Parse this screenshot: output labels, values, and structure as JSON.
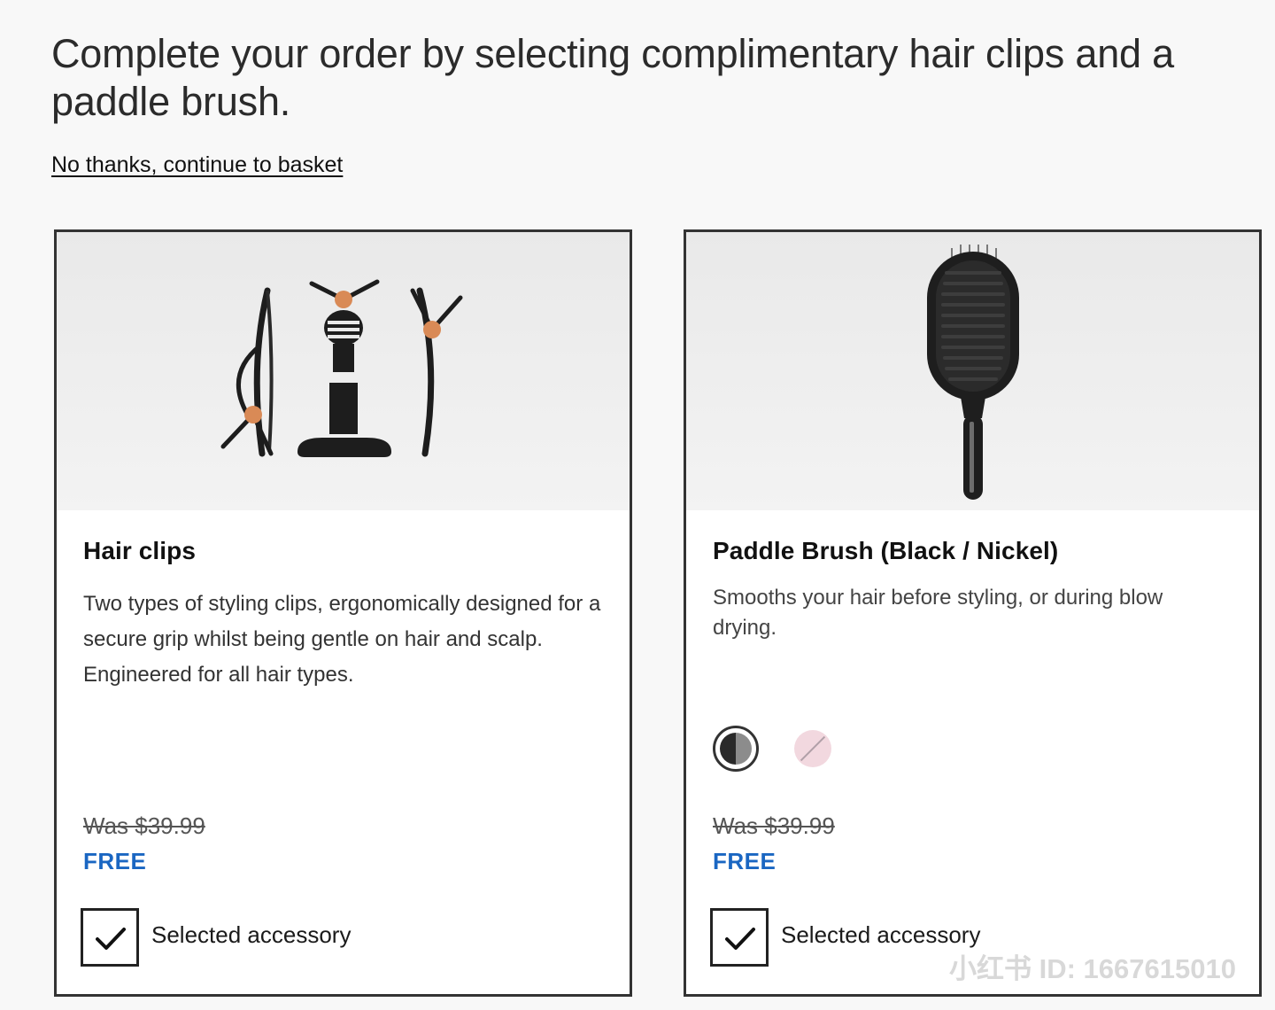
{
  "page": {
    "heading": "Complete your order by selecting complimentary hair clips and a paddle brush.",
    "skip_link": "No thanks, continue to basket"
  },
  "products": [
    {
      "title": "Hair clips",
      "description": "Two types of styling clips, ergonomically designed for a secure grip whilst being gentle on hair and scalp. Engineered for all hair types.",
      "was_price": "Was $39.99",
      "price": "FREE",
      "checkbox_label": "Selected accessory",
      "checked": true
    },
    {
      "title": "Paddle Brush (Black / Nickel)",
      "description": "Smooths your hair before styling, or during blow drying.",
      "swatches": [
        {
          "name": "Black / Nickel",
          "selected": true,
          "color": "#2a2a2a"
        },
        {
          "name": "Pink",
          "selected": false,
          "color": "#f2d8df"
        }
      ],
      "was_price": "Was $39.99",
      "price": "FREE",
      "checkbox_label": "Selected accessory",
      "checked": true
    }
  ],
  "watermark": "小红书 ID: 1667615010",
  "colors": {
    "accent_blue": "#1a66c2",
    "border": "#333333",
    "page_bg": "#f8f8f8"
  }
}
